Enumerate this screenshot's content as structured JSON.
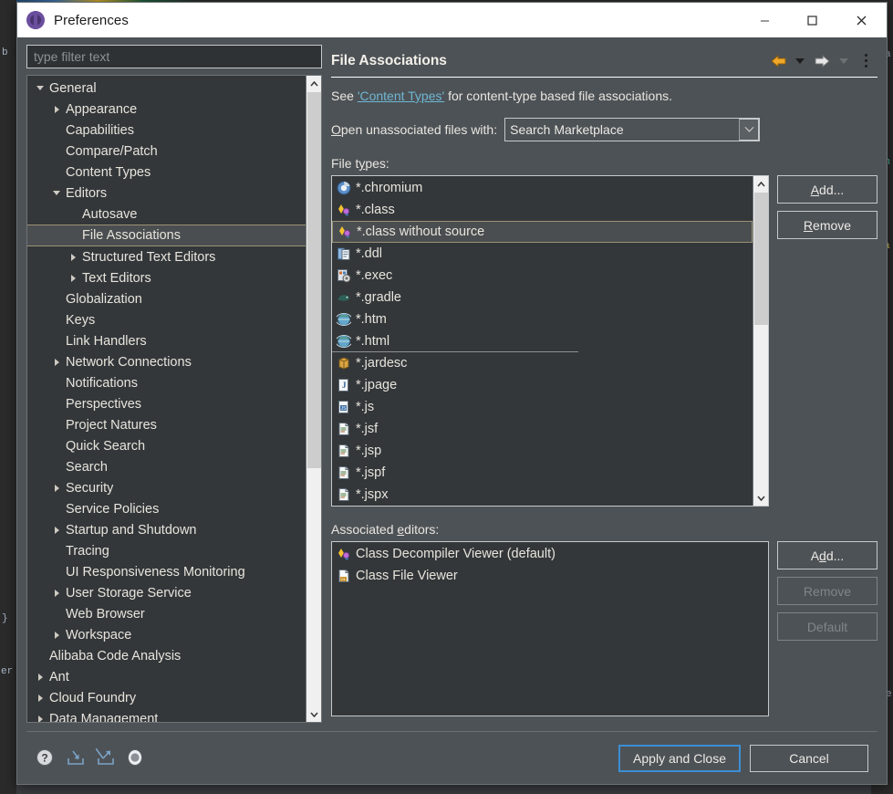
{
  "window": {
    "title": "Preferences",
    "icon": "preferences-gear-icon",
    "minimize_label": "–",
    "maximize_label": "□",
    "close_label": "✕"
  },
  "filter": {
    "placeholder": "type filter text",
    "value": ""
  },
  "tree": [
    {
      "label": "General",
      "indent": 0,
      "twisty": "expanded",
      "selected": false
    },
    {
      "label": "Appearance",
      "indent": 1,
      "twisty": "collapsed",
      "selected": false
    },
    {
      "label": "Capabilities",
      "indent": 1,
      "twisty": "none",
      "selected": false
    },
    {
      "label": "Compare/Patch",
      "indent": 1,
      "twisty": "none",
      "selected": false
    },
    {
      "label": "Content Types",
      "indent": 1,
      "twisty": "none",
      "selected": false
    },
    {
      "label": "Editors",
      "indent": 1,
      "twisty": "expanded",
      "selected": false
    },
    {
      "label": "Autosave",
      "indent": 2,
      "twisty": "none",
      "selected": false
    },
    {
      "label": "File Associations",
      "indent": 2,
      "twisty": "none",
      "selected": true
    },
    {
      "label": "Structured Text Editors",
      "indent": 2,
      "twisty": "collapsed",
      "selected": false
    },
    {
      "label": "Text Editors",
      "indent": 2,
      "twisty": "collapsed",
      "selected": false
    },
    {
      "label": "Globalization",
      "indent": 1,
      "twisty": "none",
      "selected": false
    },
    {
      "label": "Keys",
      "indent": 1,
      "twisty": "none",
      "selected": false
    },
    {
      "label": "Link Handlers",
      "indent": 1,
      "twisty": "none",
      "selected": false
    },
    {
      "label": "Network Connections",
      "indent": 1,
      "twisty": "collapsed",
      "selected": false
    },
    {
      "label": "Notifications",
      "indent": 1,
      "twisty": "none",
      "selected": false
    },
    {
      "label": "Perspectives",
      "indent": 1,
      "twisty": "none",
      "selected": false
    },
    {
      "label": "Project Natures",
      "indent": 1,
      "twisty": "none",
      "selected": false
    },
    {
      "label": "Quick Search",
      "indent": 1,
      "twisty": "none",
      "selected": false
    },
    {
      "label": "Search",
      "indent": 1,
      "twisty": "none",
      "selected": false
    },
    {
      "label": "Security",
      "indent": 1,
      "twisty": "collapsed",
      "selected": false
    },
    {
      "label": "Service Policies",
      "indent": 1,
      "twisty": "none",
      "selected": false
    },
    {
      "label": "Startup and Shutdown",
      "indent": 1,
      "twisty": "collapsed",
      "selected": false
    },
    {
      "label": "Tracing",
      "indent": 1,
      "twisty": "none",
      "selected": false
    },
    {
      "label": "UI Responsiveness Monitoring",
      "indent": 1,
      "twisty": "none",
      "selected": false
    },
    {
      "label": "User Storage Service",
      "indent": 1,
      "twisty": "collapsed",
      "selected": false
    },
    {
      "label": "Web Browser",
      "indent": 1,
      "twisty": "none",
      "selected": false
    },
    {
      "label": "Workspace",
      "indent": 1,
      "twisty": "collapsed",
      "selected": false
    },
    {
      "label": "Alibaba Code Analysis",
      "indent": 0,
      "twisty": "none",
      "selected": false
    },
    {
      "label": "Ant",
      "indent": 0,
      "twisty": "collapsed",
      "selected": false
    },
    {
      "label": "Cloud Foundry",
      "indent": 0,
      "twisty": "collapsed",
      "selected": false
    },
    {
      "label": "Data Management",
      "indent": 0,
      "twisty": "collapsed",
      "selected": false
    }
  ],
  "page": {
    "title": "File Associations",
    "nav": {
      "back_icon": "back-arrow-icon",
      "back_menu_icon": "chevron-down-icon",
      "forward_icon": "forward-arrow-icon",
      "forward_menu_icon": "chevron-down-icon",
      "menu_icon": "kebab-menu-icon"
    },
    "description_prefix": "See ",
    "description_link": "'Content Types'",
    "description_suffix": " for content-type based file associations.",
    "open_with_label": "Open unassociated files with:",
    "open_with_value": "Search Marketplace",
    "file_types_label": "File types:",
    "associated_editors_label": "Associated editors:"
  },
  "file_types": {
    "items": [
      {
        "label": "*.chromium",
        "icon": "chromium-icon",
        "selected": false,
        "focus": false
      },
      {
        "label": "*.class",
        "icon": "class-icon",
        "selected": false,
        "focus": false
      },
      {
        "label": "*.class without source",
        "icon": "class-icon",
        "selected": true,
        "focus": false
      },
      {
        "label": "*.ddl",
        "icon": "ddl-icon",
        "selected": false,
        "focus": false
      },
      {
        "label": "*.exec",
        "icon": "exec-icon",
        "selected": false,
        "focus": false
      },
      {
        "label": "*.gradle",
        "icon": "gradle-icon",
        "selected": false,
        "focus": false
      },
      {
        "label": "*.htm",
        "icon": "globe-icon",
        "selected": false,
        "focus": false
      },
      {
        "label": "*.html",
        "icon": "globe-icon",
        "selected": false,
        "focus": true
      },
      {
        "label": "*.jardesc",
        "icon": "jar-icon",
        "selected": false,
        "focus": false
      },
      {
        "label": "*.jpage",
        "icon": "jpage-icon",
        "selected": false,
        "focus": false
      },
      {
        "label": "*.js",
        "icon": "js-icon",
        "selected": false,
        "focus": false
      },
      {
        "label": "*.jsf",
        "icon": "doc-icon",
        "selected": false,
        "focus": false
      },
      {
        "label": "*.jsp",
        "icon": "doc-icon",
        "selected": false,
        "focus": false
      },
      {
        "label": "*.jspf",
        "icon": "doc-icon",
        "selected": false,
        "focus": false
      },
      {
        "label": "*.jspx",
        "icon": "doc-icon",
        "selected": false,
        "focus": false
      }
    ],
    "buttons": [
      {
        "label": "Add...",
        "accesskey": "A",
        "disabled": false,
        "name": "filetypes-add-button"
      },
      {
        "label": "Remove",
        "accesskey": "R",
        "disabled": false,
        "name": "filetypes-remove-button"
      }
    ]
  },
  "associated_editors": {
    "items": [
      {
        "label": "Class Decompiler Viewer (default)",
        "icon": "class-icon"
      },
      {
        "label": "Class File Viewer",
        "icon": "classfile-icon"
      }
    ],
    "buttons": [
      {
        "label": "Add...",
        "accesskey": "d",
        "disabled": false,
        "name": "editors-add-button"
      },
      {
        "label": "Remove",
        "accesskey": "",
        "disabled": true,
        "name": "editors-remove-button"
      },
      {
        "label": "Default",
        "accesskey": "",
        "disabled": true,
        "name": "editors-default-button"
      }
    ]
  },
  "footer": {
    "icons": [
      {
        "name": "help-icon",
        "glyph": "?"
      },
      {
        "name": "import-icon",
        "glyph": "import"
      },
      {
        "name": "export-icon",
        "glyph": "export"
      },
      {
        "name": "sphere-icon",
        "glyph": "sphere"
      }
    ],
    "apply_and_close_label": "Apply and Close",
    "cancel_label": "Cancel"
  },
  "colors": {
    "dialog_bg": "#4d5256",
    "list_bg": "#33373a",
    "selection_border": "#9a9274",
    "link": "#6fb7d4",
    "primary_focus": "#3c8fd4",
    "titlebar_bg": "#ffffff"
  },
  "background": {
    "snippets": [
      "b",
      "}",
      "er",
      "a",
      "m",
      "a",
      "e"
    ]
  }
}
